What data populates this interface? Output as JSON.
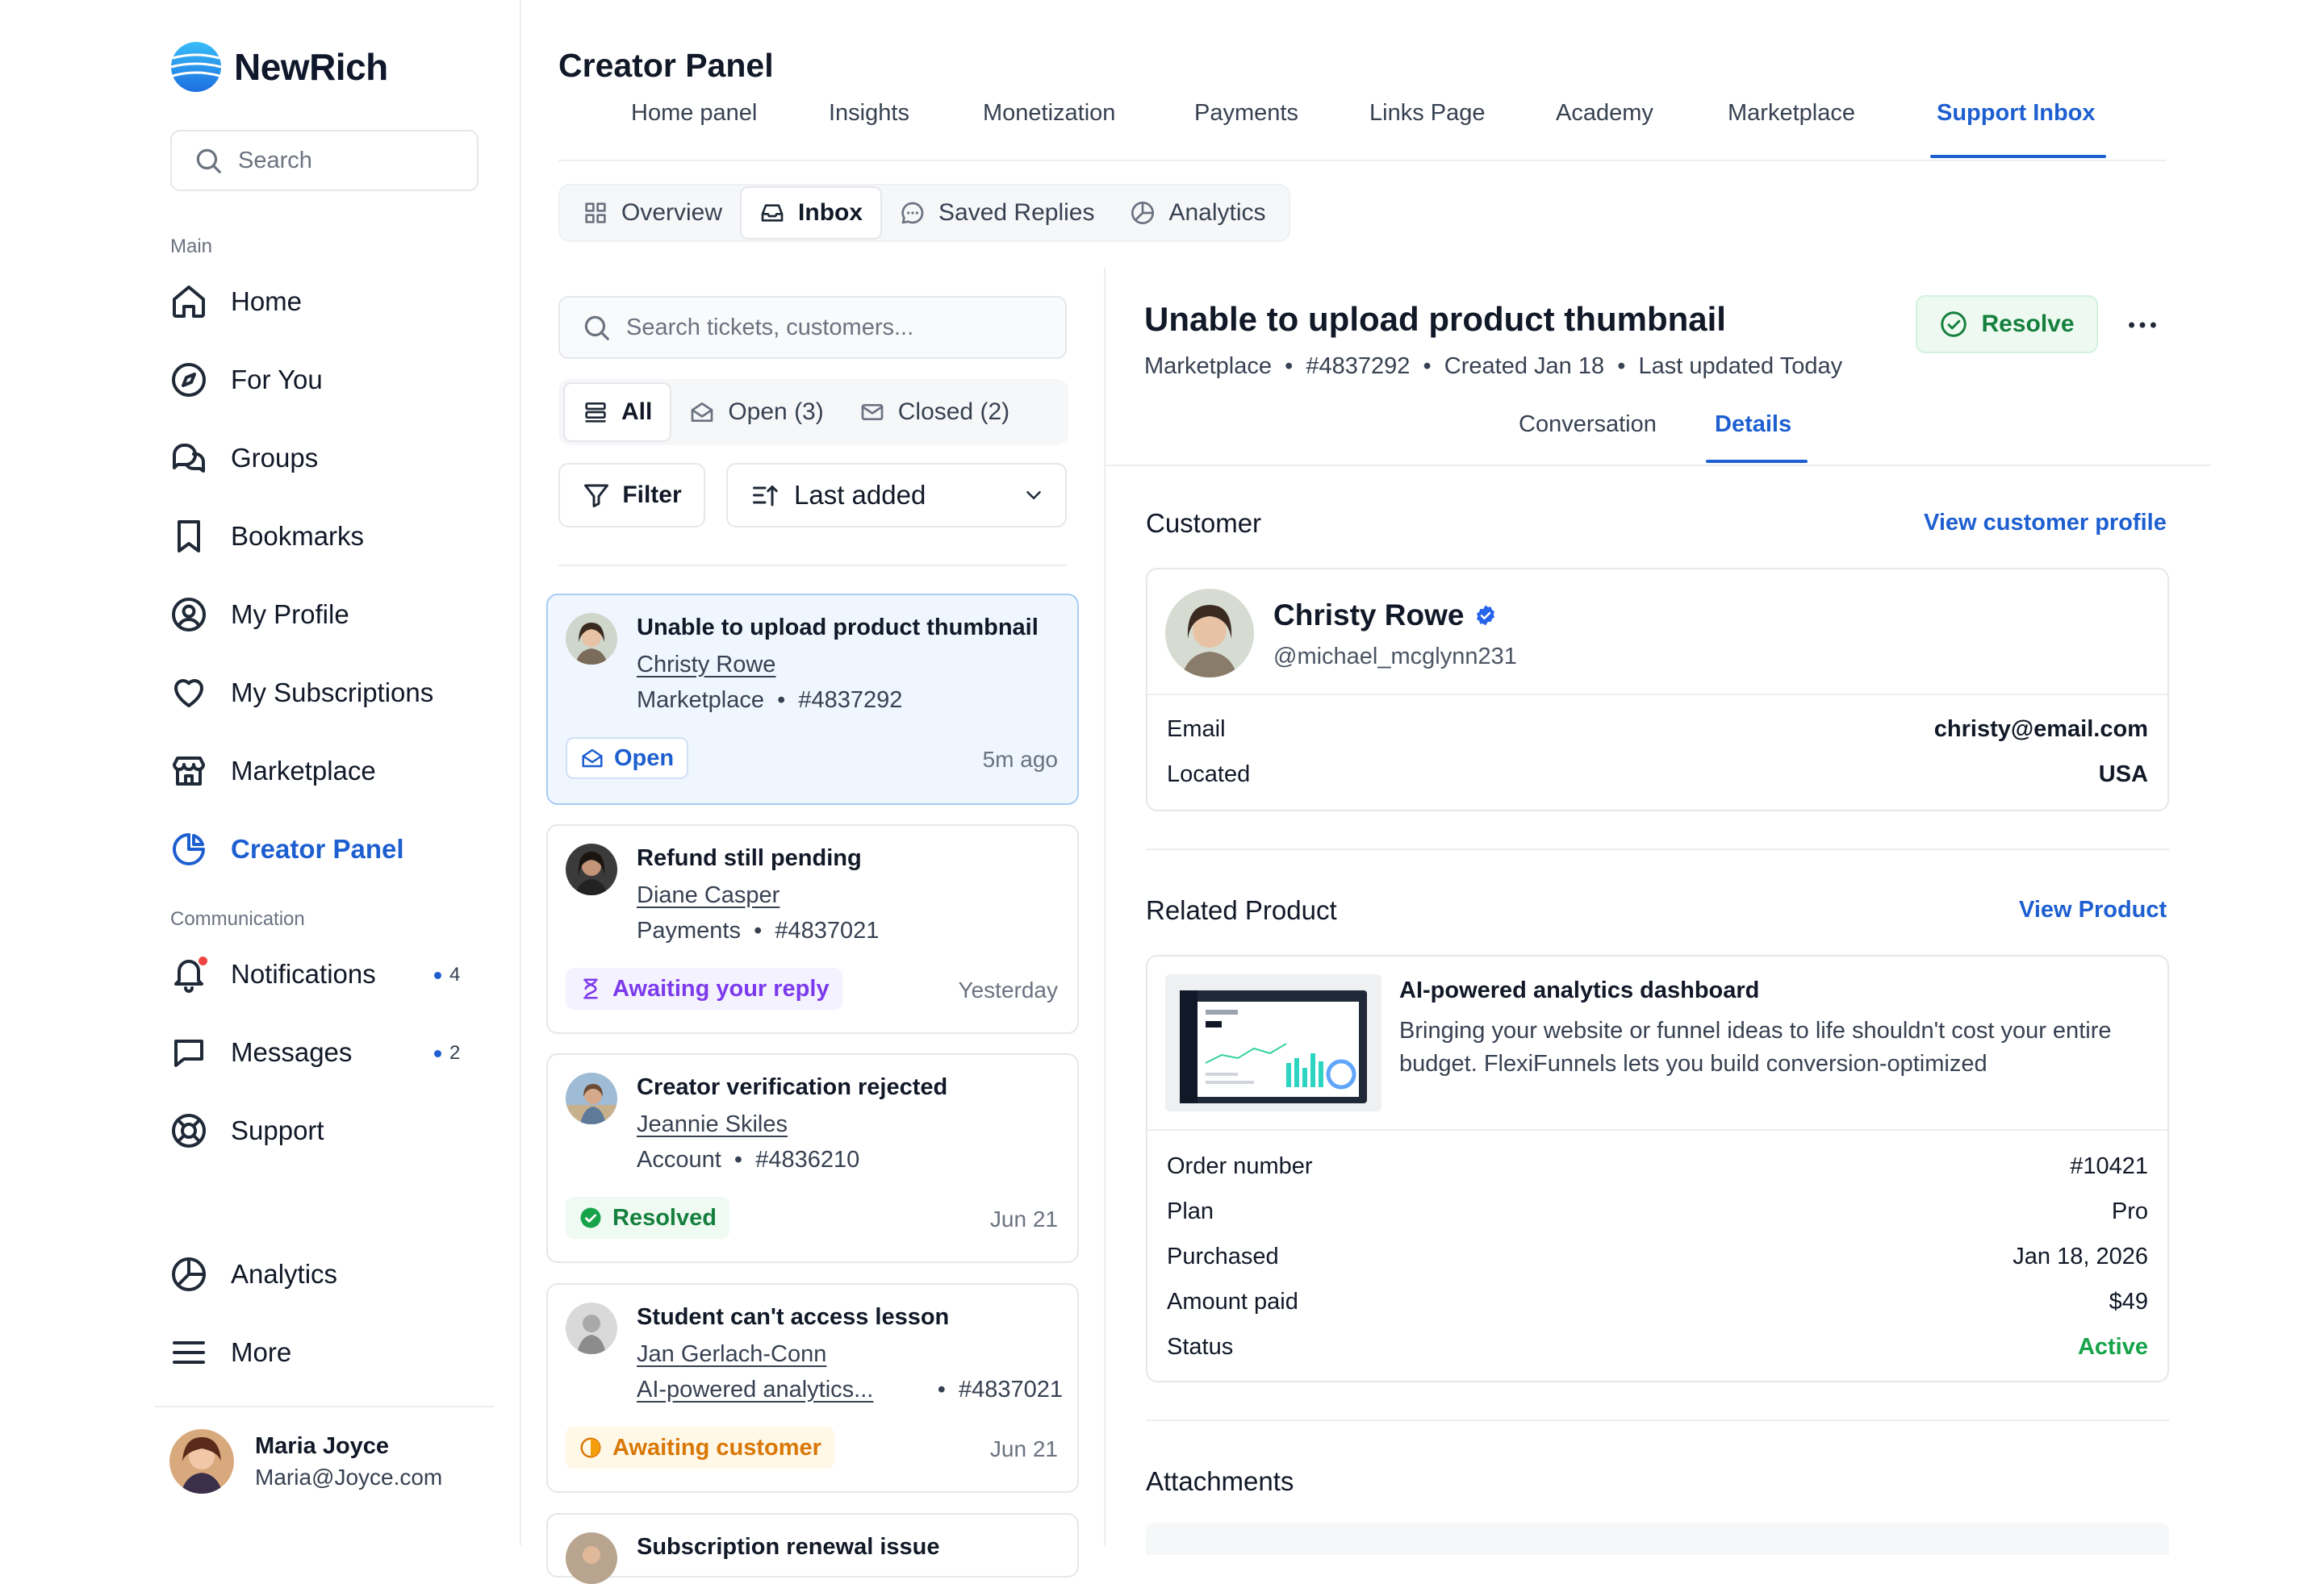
{
  "app": {
    "name": "NewRich"
  },
  "sidebar": {
    "search_placeholder": "Search",
    "main_label": "Main",
    "main_items": [
      {
        "label": "Home",
        "icon": "home-icon"
      },
      {
        "label": "For You",
        "icon": "compass-icon"
      },
      {
        "label": "Groups",
        "icon": "chat-bubbles-icon"
      },
      {
        "label": "Bookmarks",
        "icon": "bookmark-icon"
      },
      {
        "label": "My Profile",
        "icon": "user-circle-icon"
      },
      {
        "label": "My Subscriptions",
        "icon": "heart-icon"
      },
      {
        "label": "Marketplace",
        "icon": "store-icon"
      },
      {
        "label": "Creator Panel",
        "icon": "pie-chart-icon",
        "active": true
      }
    ],
    "communication_label": "Communication",
    "comm_items": [
      {
        "label": "Notifications",
        "icon": "bell-icon",
        "count": "4"
      },
      {
        "label": "Messages",
        "icon": "message-icon",
        "count": "2"
      },
      {
        "label": "Support",
        "icon": "lifebuoy-icon"
      }
    ],
    "bottom_items": [
      {
        "label": "Analytics",
        "icon": "chart-pie-icon"
      },
      {
        "label": "More",
        "icon": "menu-icon"
      }
    ],
    "user": {
      "name": "Maria Joyce",
      "email": "Maria@Joyce.com"
    }
  },
  "header": {
    "title": "Creator Panel",
    "tabs": [
      "Home panel",
      "Insights",
      "Monetization",
      "Payments",
      "Links Page",
      "Academy",
      "Marketplace",
      "Support Inbox"
    ],
    "active_tab": "Support Inbox"
  },
  "subtabs": {
    "items": [
      {
        "label": "Overview",
        "icon": "grid-icon"
      },
      {
        "label": "Inbox",
        "icon": "inbox-icon",
        "active": true
      },
      {
        "label": "Saved Replies",
        "icon": "chat-dots-icon"
      },
      {
        "label": "Analytics",
        "icon": "chart-pie-icon"
      }
    ]
  },
  "inbox": {
    "search_placeholder": "Search tickets, customers...",
    "filters": [
      {
        "label": "All",
        "active": true
      },
      {
        "label": "Open (3)"
      },
      {
        "label": "Closed (2)"
      }
    ],
    "filter_button": "Filter",
    "sort_value": "Last added",
    "tickets": [
      {
        "title": "Unable to upload product thumbnail",
        "customer": "Christy Rowe",
        "category": "Marketplace",
        "id": "#4837292",
        "status": "Open",
        "time": "5m ago"
      },
      {
        "title": "Refund still pending",
        "customer": "Diane Casper",
        "category": "Payments",
        "id": "#4837021",
        "status": "Awaiting your reply",
        "time": "Yesterday"
      },
      {
        "title": "Creator verification rejected",
        "customer": "Jeannie Skiles",
        "category": "Account",
        "id": "#4836210",
        "status": "Resolved",
        "time": "Jun 21"
      },
      {
        "title": "Student can't access lesson",
        "customer": "Jan Gerlach-Conn",
        "category": "AI-powered analytics...",
        "id": "#4837021",
        "status": "Awaiting customer",
        "time": "Jun 21"
      },
      {
        "title": "Subscription renewal issue"
      }
    ]
  },
  "detail": {
    "title": "Unable to upload product thumbnail",
    "meta": [
      "Marketplace",
      "#4837292",
      "Created Jan 18",
      "Last updated Today"
    ],
    "resolve_label": "Resolve",
    "tabs": [
      "Conversation",
      "Details"
    ],
    "active_tab": "Details",
    "customer": {
      "section_title": "Customer",
      "link": "View customer profile",
      "name": "Christy Rowe",
      "handle": "@michael_mcglynn231",
      "fields": [
        {
          "k": "Email",
          "v": "christy@email.com"
        },
        {
          "k": "Located",
          "v": "USA"
        }
      ]
    },
    "product": {
      "section_title": "Related Product",
      "link": "View Product",
      "name": "AI-powered analytics dashboard",
      "description": "Bringing your website or funnel ideas to life shouldn't cost your entire budget. FlexiFunnels lets you build conversion-optimized",
      "fields": [
        {
          "k": "Order number",
          "v": "#10421"
        },
        {
          "k": "Plan",
          "v": "Pro"
        },
        {
          "k": "Purchased",
          "v": "Jan 18, 2026"
        },
        {
          "k": "Amount paid",
          "v": "$49"
        },
        {
          "k": "Status",
          "v": "Active"
        }
      ]
    },
    "attachments_title": "Attachments"
  },
  "colors": {
    "accent": "#1d5fd0",
    "success": "#15803d",
    "purple": "#7c3aed",
    "amber": "#d97706"
  }
}
